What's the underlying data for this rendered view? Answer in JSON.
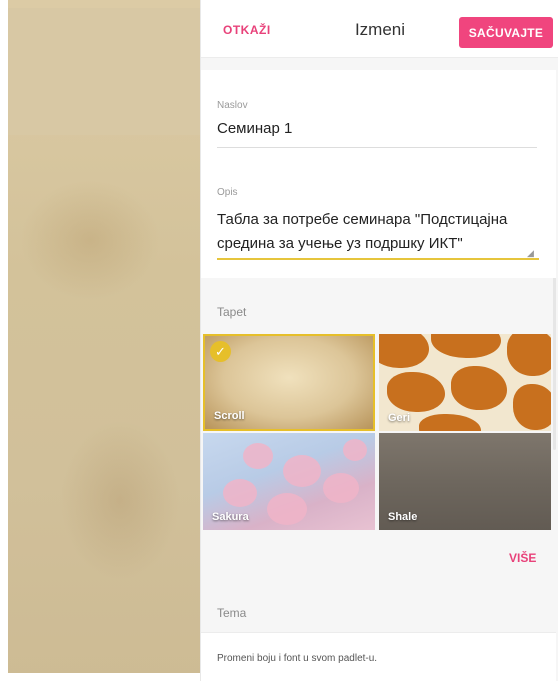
{
  "header": {
    "cancel_label": "OTKAŽI",
    "title": "Izmeni",
    "save_label": "SAČUVAJTE"
  },
  "form": {
    "title_label": "Naslov",
    "title_value": "Семинар 1",
    "description_label": "Opis",
    "description_value": "Табла за потребе семинара \"Подстицајна средина за учење уз подршку ИКТ\""
  },
  "wallpaper": {
    "section_label": "Tapet",
    "selected": "Scroll",
    "tiles": [
      {
        "name": "Scroll"
      },
      {
        "name": "Geri"
      },
      {
        "name": "Sakura"
      },
      {
        "name": "Shale"
      }
    ],
    "more_label": "VIŠE"
  },
  "theme": {
    "section_label": "Tema",
    "description": "Promeni boju i font u svom padlet-u."
  },
  "colors": {
    "accent": "#f0457e",
    "selection": "#e6bf2a"
  }
}
